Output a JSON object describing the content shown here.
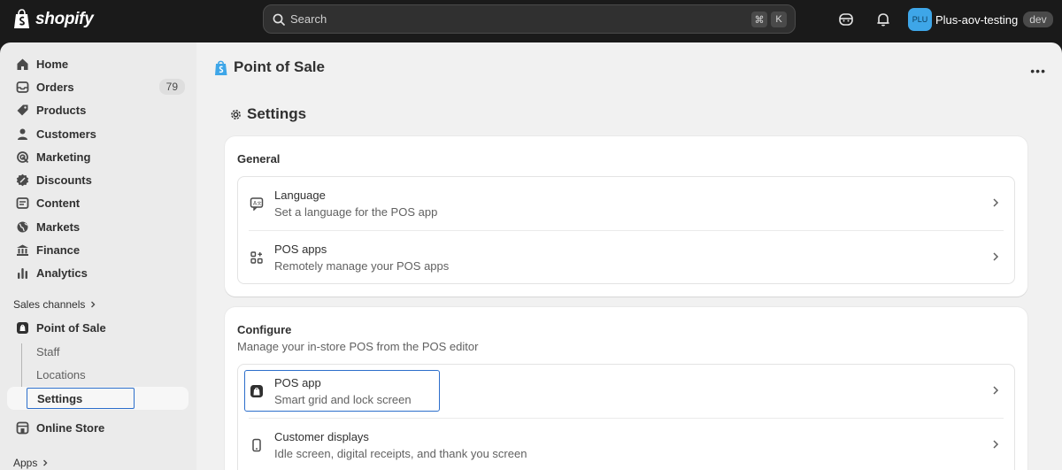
{
  "topbar": {
    "brand": "shopify",
    "search_placeholder": "Search",
    "shortcut_keys": [
      "⌘",
      "K"
    ],
    "store_initials": "PLU",
    "store_name": "Plus-aov-testing",
    "store_badge": "dev"
  },
  "sidebar": {
    "items": [
      {
        "label": "Home",
        "icon": "home-icon"
      },
      {
        "label": "Orders",
        "icon": "orders-icon",
        "count": "79"
      },
      {
        "label": "Products",
        "icon": "tag-icon"
      },
      {
        "label": "Customers",
        "icon": "person-icon"
      },
      {
        "label": "Marketing",
        "icon": "target-icon"
      },
      {
        "label": "Discounts",
        "icon": "discount-icon"
      },
      {
        "label": "Content",
        "icon": "content-icon"
      },
      {
        "label": "Markets",
        "icon": "globe-icon"
      },
      {
        "label": "Finance",
        "icon": "bank-icon"
      },
      {
        "label": "Analytics",
        "icon": "bar-chart-icon"
      }
    ],
    "sales_channels_label": "Sales channels",
    "pos_label": "Point of Sale",
    "pos_sub_items": [
      "Staff",
      "Locations",
      "Settings"
    ],
    "online_store_label": "Online Store",
    "apps_label": "Apps"
  },
  "main": {
    "page_title": "Point of Sale",
    "settings_title": "Settings",
    "general": {
      "title": "General",
      "rows": [
        {
          "title": "Language",
          "subtitle": "Set a language for the POS app",
          "icon": "language-icon"
        },
        {
          "title": "POS apps",
          "subtitle": "Remotely manage your POS apps",
          "icon": "apps-icon"
        }
      ]
    },
    "configure": {
      "title": "Configure",
      "description": "Manage your in-store POS from the POS editor",
      "rows": [
        {
          "title": "POS app",
          "subtitle": "Smart grid and lock screen",
          "icon": "pos-app-icon"
        },
        {
          "title": "Customer displays",
          "subtitle": "Idle screen, digital receipts, and thank you screen",
          "icon": "tablet-icon"
        }
      ]
    }
  },
  "colors": {
    "accent": "#2c6ecb",
    "topbar": "#1a1a1a",
    "avatar": "#3ea6e8"
  }
}
